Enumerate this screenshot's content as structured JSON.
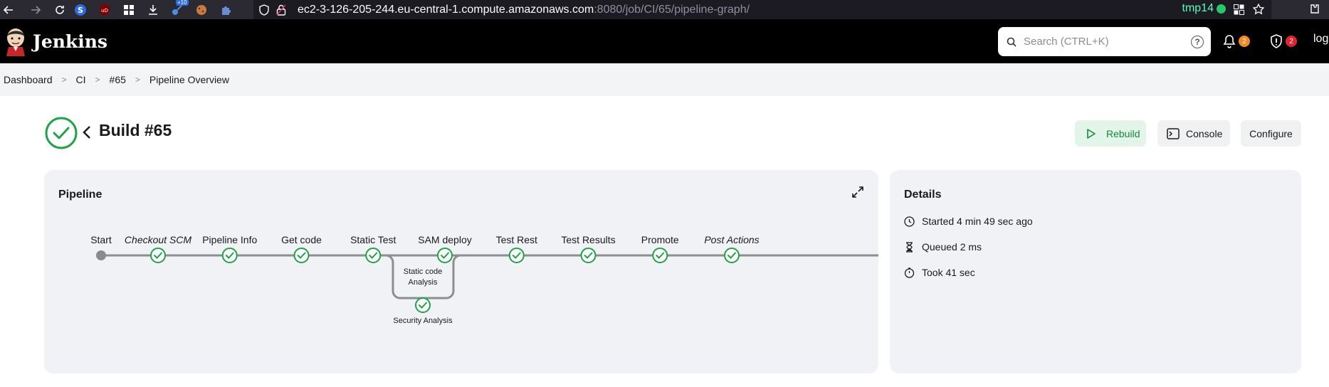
{
  "browser": {
    "url_host": "ec2-3-126-205-244.eu-central-1.compute.amazonaws.com",
    "url_path": ":8080/job/CI/65/pipeline-graph/",
    "container_label": "tmp14",
    "extension_badge": "+10"
  },
  "header": {
    "app_title": "Jenkins",
    "search_placeholder": "Search (CTRL+K)",
    "notifications_count": "2",
    "security_count": "2",
    "logout_label": "log"
  },
  "breadcrumb": [
    "Dashboard",
    "CI",
    "#65",
    "Pipeline Overview"
  ],
  "build": {
    "title": "Build #65",
    "status": "success",
    "rebuild_label": "Rebuild",
    "console_label": "Console",
    "configure_label": "Configure"
  },
  "pipeline": {
    "title": "Pipeline",
    "start_label": "Start",
    "stages": [
      {
        "label": "Checkout SCM",
        "italic": true
      },
      {
        "label": "Pipeline Info",
        "italic": false
      },
      {
        "label": "Get code",
        "italic": false
      },
      {
        "label": "Static Test",
        "italic": false,
        "parallel": [
          "Static code Analysis",
          "Security Analysis"
        ]
      },
      {
        "label": "SAM deploy",
        "italic": false
      },
      {
        "label": "Test Rest",
        "italic": false
      },
      {
        "label": "Test Results",
        "italic": false
      },
      {
        "label": "Promote",
        "italic": false
      },
      {
        "label": "Post Actions",
        "italic": true
      }
    ],
    "parallel_labels": {
      "line1": "Static code",
      "line2": "Analysis",
      "security": "Security Analysis"
    }
  },
  "details": {
    "title": "Details",
    "started": "Started 4 min 49 sec ago",
    "queued": "Queued 2 ms",
    "took": "Took 41 sec"
  },
  "colors": {
    "success": "#1ea446",
    "rebuild_text": "#138a3c",
    "panel_bg": "#f0f2f5",
    "connector": "#8e8e8e"
  }
}
